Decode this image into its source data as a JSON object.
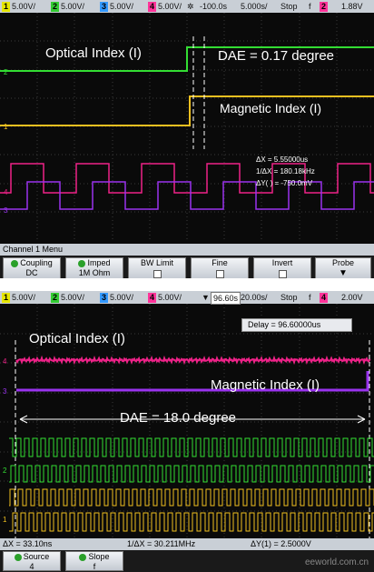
{
  "scope1": {
    "topbar": {
      "ch1": {
        "num": "1",
        "scale": "5.00V/"
      },
      "ch2": {
        "num": "2",
        "scale": "5.00V/"
      },
      "ch3": {
        "num": "3",
        "scale": "5.00V/"
      },
      "ch4": {
        "num": "4",
        "scale": "5.00V/"
      },
      "delay": "-100.0s",
      "timebase": "5.000s/",
      "run_state": "Stop",
      "trig_slope": "f",
      "trig_channel": "2",
      "trig_level": "1.88V"
    },
    "annotations": {
      "optical": "Optical Index (I)",
      "dae": "DAE = 0.17 degree",
      "magnetic": "Magnetic Index (I)"
    },
    "measurements": {
      "dx": "ΔX = 5.55000us",
      "inv_dx": "1/ΔX = 180.18kHz",
      "dy": "ΔY(  ) = -750.0mV"
    },
    "menu": {
      "title": "Channel 1  Menu",
      "coupling_label": "Coupling",
      "coupling_value": "DC",
      "imped_label": "Imped",
      "imped_value": "1M Ohm",
      "bw_limit": "BW Limit",
      "fine": "Fine",
      "invert": "Invert",
      "probe": "Probe"
    },
    "colors": {
      "green": "#33dd33",
      "yellow": "#f0c020",
      "magenta": "#ee2288",
      "purple": "#9933ee"
    }
  },
  "scope2": {
    "topbar": {
      "ch1": {
        "num": "1",
        "scale": "5.00V/"
      },
      "ch2": {
        "num": "2",
        "scale": "5.00V/"
      },
      "ch3": {
        "num": "3",
        "scale": "5.00V/"
      },
      "ch4": {
        "num": "4",
        "scale": "5.00V/"
      },
      "delay": "96.60s",
      "timebase": "20.00s/",
      "run_state": "Stop",
      "trig_slope": "f",
      "trig_channel": "4",
      "trig_level": "2.00V"
    },
    "delay_box": "Delay = 96.60000us",
    "annotations": {
      "optical": "Optical Index (I)",
      "magnetic": "Magnetic Index (I)",
      "dae": "DAE = 18.0 degree"
    },
    "bottombar": {
      "dx": "ΔX = 33.10ns",
      "inv_dx": "1/ΔX = 30.211MHz",
      "dy": "ΔY(1) = 2.5000V"
    },
    "softkeys": {
      "source_label": "Source",
      "source_value": "4",
      "slope_label": "Slope",
      "slope_value": "f"
    },
    "watermark": "eeworld.com.cn"
  }
}
